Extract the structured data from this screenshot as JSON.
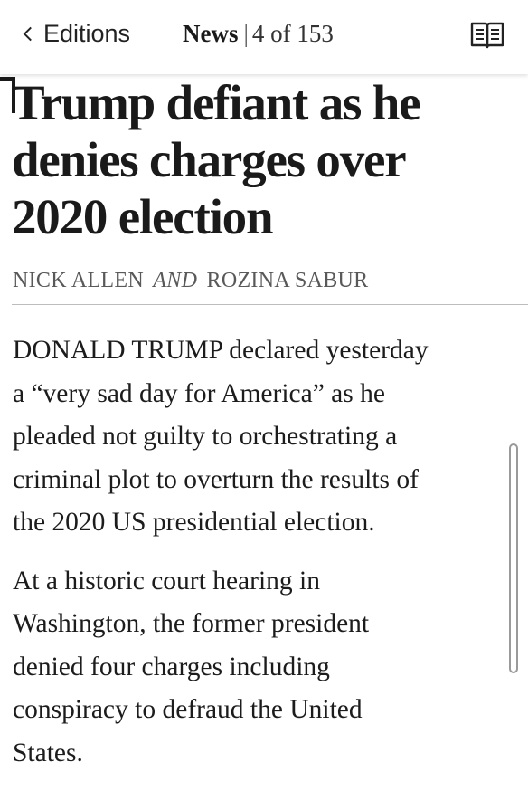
{
  "topbar": {
    "back_label": "Editions",
    "section": "News",
    "separator": "|",
    "position": "4 of 153",
    "reader_icon": "open-book-icon"
  },
  "article": {
    "headline_lines": [
      "Trump defiant as he",
      "denies charges over",
      "2020 election"
    ],
    "byline": {
      "author1": "NICK ALLEN",
      "conjunction": "AND",
      "author2": "ROZINA SABUR"
    },
    "paragraphs": [
      {
        "lines": [
          "DONALD TRUMP declared yesterday",
          "a “very sad day for America” as he",
          "pleaded not guilty to orchestrating a",
          "criminal plot to overturn the results of",
          "the 2020 US presidential election."
        ]
      },
      {
        "lines": [
          "At a historic court hearing in",
          "Washington, the former president",
          "denied four charges including",
          "conspiracy to defraud the United",
          "States."
        ]
      }
    ]
  }
}
